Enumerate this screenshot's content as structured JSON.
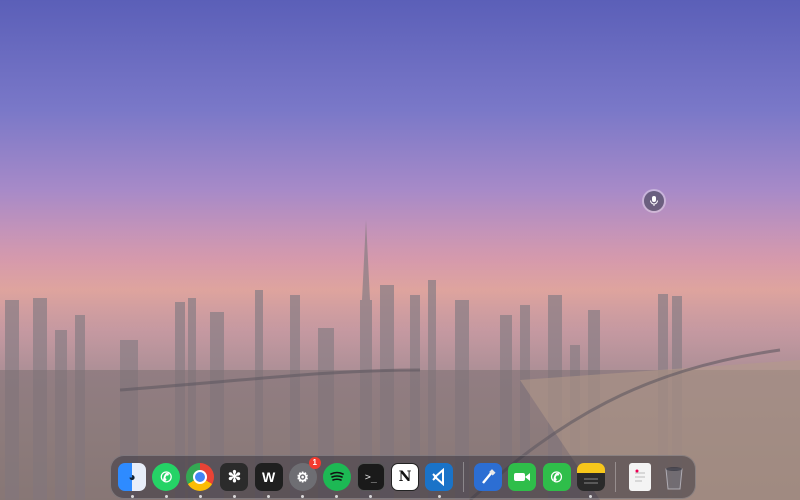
{
  "desktop": {
    "dictation": {
      "icon": "microphone-icon"
    }
  },
  "dock": {
    "apps": [
      {
        "name": "Finder",
        "icon": "finder-icon",
        "running": true
      },
      {
        "name": "WhatsApp",
        "icon": "whatsapp-icon",
        "running": true
      },
      {
        "name": "Chrome",
        "icon": "chrome-icon",
        "running": true
      },
      {
        "name": "ChatGPT",
        "icon": "chatgpt-icon",
        "running": true
      },
      {
        "name": "Wispr",
        "icon": "w-icon",
        "running": true
      },
      {
        "name": "System Settings",
        "icon": "settings-icon",
        "running": true,
        "badge": "1"
      },
      {
        "name": "Spotify",
        "icon": "spotify-icon",
        "running": true
      },
      {
        "name": "Terminal",
        "icon": "terminal-icon",
        "running": true
      },
      {
        "name": "Notion",
        "icon": "notion-icon",
        "running": false
      },
      {
        "name": "VS Code",
        "icon": "vscode-icon",
        "running": true
      },
      {
        "name": "Xcode",
        "icon": "hammer-icon",
        "running": false
      },
      {
        "name": "FaceTime",
        "icon": "facetime-icon",
        "running": false
      },
      {
        "name": "Phone",
        "icon": "phone-icon",
        "running": false
      },
      {
        "name": "Notes",
        "icon": "notes-icon",
        "running": true
      },
      {
        "name": "Document",
        "icon": "document-icon",
        "running": false
      },
      {
        "name": "Trash",
        "icon": "trash-icon",
        "running": false
      }
    ],
    "badge_color": "#f23b2f"
  }
}
